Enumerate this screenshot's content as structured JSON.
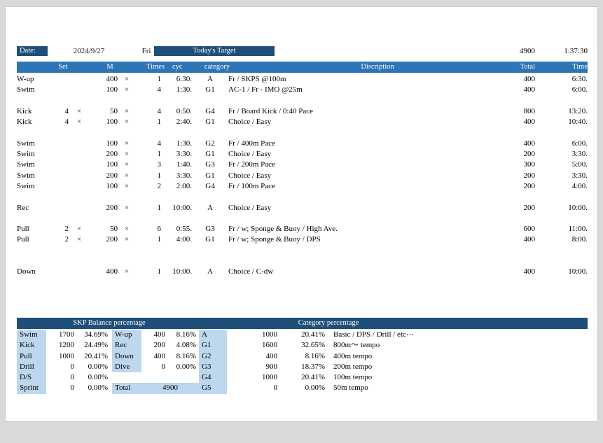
{
  "top": {
    "date_label": "Date:",
    "date_value": "2024/9/27",
    "day_of_week": "Fri",
    "target_banner": "Today's Target",
    "target_total": "4900",
    "target_time": "1:37:30"
  },
  "main_header": {
    "set": "Set",
    "m": "M",
    "times": "Times",
    "cyc": "cyc",
    "category": "category",
    "discription": "Discription",
    "total": "Total",
    "time": "Time"
  },
  "workout_rows": [
    {
      "type": "W-up",
      "sets": "",
      "x1": "",
      "dist": "400",
      "x2": "×",
      "reps": "1",
      "cyc": "6:30.",
      "cat": "A",
      "desc": "Fr / SKPS @100m",
      "total": "400",
      "time": "6:30.",
      "spacer": false
    },
    {
      "type": "Swim",
      "sets": "",
      "x1": "",
      "dist": "100",
      "x2": "×",
      "reps": "4",
      "cyc": "1:30.",
      "cat": "G1",
      "desc": "AC-1 / Fr - IMO @25m",
      "total": "400",
      "time": "6:00.",
      "spacer": false
    },
    {
      "type": "",
      "sets": "",
      "x1": "",
      "dist": "",
      "x2": "",
      "reps": "",
      "cyc": "",
      "cat": "",
      "desc": "",
      "total": "",
      "time": "",
      "spacer": true
    },
    {
      "type": "Kick",
      "sets": "4",
      "x1": "×",
      "dist": "50",
      "x2": "×",
      "reps": "4",
      "cyc": "0:50.",
      "cat": "G4",
      "desc": "Fr / Board Kick / 0:40 Pace",
      "total": "800",
      "time": "13:20.",
      "spacer": false
    },
    {
      "type": "Kick",
      "sets": "4",
      "x1": "×",
      "dist": "100",
      "x2": "×",
      "reps": "1",
      "cyc": "2:40.",
      "cat": "G1",
      "desc": "Choice / Easy",
      "total": "400",
      "time": "10:40.",
      "spacer": false
    },
    {
      "type": "",
      "sets": "",
      "x1": "",
      "dist": "",
      "x2": "",
      "reps": "",
      "cyc": "",
      "cat": "",
      "desc": "",
      "total": "",
      "time": "",
      "spacer": true
    },
    {
      "type": "Swim",
      "sets": "",
      "x1": "",
      "dist": "100",
      "x2": "×",
      "reps": "4",
      "cyc": "1:30.",
      "cat": "G2",
      "desc": "Fr / 400m Pace",
      "total": "400",
      "time": "6:00.",
      "spacer": false
    },
    {
      "type": "Swim",
      "sets": "",
      "x1": "",
      "dist": "200",
      "x2": "×",
      "reps": "1",
      "cyc": "3:30.",
      "cat": "G1",
      "desc": "Choice / Easy",
      "total": "200",
      "time": "3:30.",
      "spacer": false
    },
    {
      "type": "Swim",
      "sets": "",
      "x1": "",
      "dist": "100",
      "x2": "×",
      "reps": "3",
      "cyc": "1:40.",
      "cat": "G3",
      "desc": "Fr / 200m Pace",
      "total": "300",
      "time": "5:00.",
      "spacer": false
    },
    {
      "type": "Swim",
      "sets": "",
      "x1": "",
      "dist": "200",
      "x2": "×",
      "reps": "1",
      "cyc": "3:30.",
      "cat": "G1",
      "desc": "Choice / Easy",
      "total": "200",
      "time": "3:30.",
      "spacer": false
    },
    {
      "type": "Swim",
      "sets": "",
      "x1": "",
      "dist": "100",
      "x2": "×",
      "reps": "2",
      "cyc": "2:00.",
      "cat": "G4",
      "desc": "Fr / 100m Pace",
      "total": "200",
      "time": "4:00.",
      "spacer": false
    },
    {
      "type": "",
      "sets": "",
      "x1": "",
      "dist": "",
      "x2": "",
      "reps": "",
      "cyc": "",
      "cat": "",
      "desc": "",
      "total": "",
      "time": "",
      "spacer": true
    },
    {
      "type": "Rec",
      "sets": "",
      "x1": "",
      "dist": "200",
      "x2": "×",
      "reps": "1",
      "cyc": "10:00.",
      "cat": "A",
      "desc": "Choice / Easy",
      "total": "200",
      "time": "10:00.",
      "spacer": false
    },
    {
      "type": "",
      "sets": "",
      "x1": "",
      "dist": "",
      "x2": "",
      "reps": "",
      "cyc": "",
      "cat": "",
      "desc": "",
      "total": "",
      "time": "",
      "spacer": true
    },
    {
      "type": "Pull",
      "sets": "2",
      "x1": "×",
      "dist": "50",
      "x2": "×",
      "reps": "6",
      "cyc": "0:55.",
      "cat": "G3",
      "desc": "Fr / w; Sponge & Buoy / High Ave.",
      "total": "600",
      "time": "11:00.",
      "spacer": false
    },
    {
      "type": "Pull",
      "sets": "2",
      "x1": "×",
      "dist": "200",
      "x2": "×",
      "reps": "1",
      "cyc": "4:00.",
      "cat": "G1",
      "desc": "Fr / w; Sponge & Buoy / DPS",
      "total": "400",
      "time": "8:00.",
      "spacer": false
    },
    {
      "type": "",
      "sets": "",
      "x1": "",
      "dist": "",
      "x2": "",
      "reps": "",
      "cyc": "",
      "cat": "",
      "desc": "",
      "total": "",
      "time": "",
      "spacer": true
    },
    {
      "type": "",
      "sets": "",
      "x1": "",
      "dist": "",
      "x2": "",
      "reps": "",
      "cyc": "",
      "cat": "",
      "desc": "",
      "total": "",
      "time": "",
      "spacer": true
    },
    {
      "type": "Down",
      "sets": "",
      "x1": "",
      "dist": "400",
      "x2": "×",
      "reps": "1",
      "cyc": "10:00.",
      "cat": "A",
      "desc": "Choice / C-dw",
      "total": "400",
      "time": "10:00.",
      "spacer": false
    }
  ],
  "summary_header": {
    "skp_title": "SKP Balance percentage",
    "category_title": "Category percentage"
  },
  "summary_rows": [
    {
      "lab": "Swim",
      "val": "1700",
      "pct": "34.69%",
      "lab2": "W-up",
      "val2": "400",
      "pct2": "8.16%",
      "glab": "A",
      "gval": "1000",
      "gpct": "20.41%",
      "gdesc": "Basic / DPS / Drill / etc⋯"
    },
    {
      "lab": "Kick",
      "val": "1200",
      "pct": "24.49%",
      "lab2": "Rec",
      "val2": "200",
      "pct2": "4.08%",
      "glab": "G1",
      "gval": "1600",
      "gpct": "32.65%",
      "gdesc": "800m～ tempo"
    },
    {
      "lab": "Pull",
      "val": "1000",
      "pct": "20.41%",
      "lab2": "Down",
      "val2": "400",
      "pct2": "8.16%",
      "glab": "G2",
      "gval": "400",
      "gpct": "8.16%",
      "gdesc": "400m tempo"
    },
    {
      "lab": "Drill",
      "val": "0",
      "pct": "0.00%",
      "lab2": "Dive",
      "val2": "0",
      "pct2": "0.00%",
      "glab": "G3",
      "gval": "900",
      "gpct": "18.37%",
      "gdesc": "200m tempo"
    },
    {
      "lab": "D/S",
      "val": "0",
      "pct": "0.00%",
      "lab2": "",
      "val2": "",
      "pct2": "",
      "glab": "G4",
      "gval": "1000",
      "gpct": "20.41%",
      "gdesc": "100m tempo"
    },
    {
      "lab": "Sprint",
      "val": "0",
      "pct": "0.00%",
      "lab2": "Total",
      "val2": "4900",
      "pct2": "",
      "glab": "G5",
      "gval": "0",
      "gpct": "0.00%",
      "gdesc": "50m tempo"
    }
  ],
  "colors": {
    "dark_navy": "#1f4e79",
    "medium_blue": "#2e75b6",
    "light_blue": "#bdd7ee",
    "page_bg": "#d9d9d9",
    "sheet_bg": "#ffffff"
  }
}
